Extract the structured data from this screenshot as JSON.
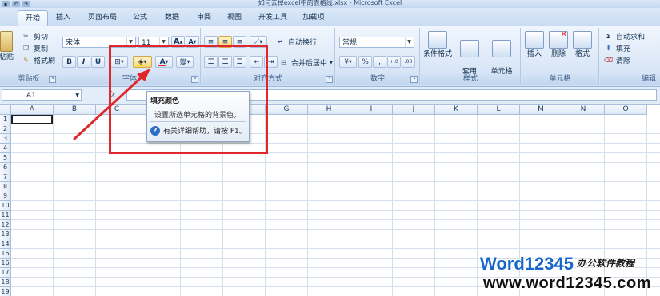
{
  "window": {
    "title": "如何去掉excel中的表格线.xlsx - Microsoft Excel"
  },
  "tabs": [
    {
      "label": "开始",
      "active": true
    },
    {
      "label": "插入"
    },
    {
      "label": "页面布局"
    },
    {
      "label": "公式"
    },
    {
      "label": "数据"
    },
    {
      "label": "审阅"
    },
    {
      "label": "视图"
    },
    {
      "label": "开发工具"
    },
    {
      "label": "加载项"
    }
  ],
  "ribbon": {
    "clipboard": {
      "paste": "粘贴",
      "cut": "剪切",
      "copy": "复制",
      "format_painter": "格式刷",
      "label": "剪贴板"
    },
    "font": {
      "font_name": "宋体",
      "font_size": "11",
      "bold": "B",
      "italic": "I",
      "underline": "U",
      "grow": "A",
      "shrink": "A",
      "font_color": "A",
      "phonetic": "變",
      "label": "字体"
    },
    "alignment": {
      "wrap_text": "自动换行",
      "merge_center": "合并后居中",
      "label": "对齐方式"
    },
    "number": {
      "format": "常规",
      "percent": "%",
      "comma": ",",
      "increase_decimal": "+.0",
      "decrease_decimal": ".00",
      "label": "数字"
    },
    "styles": {
      "conditional": "条件格式",
      "table": "套用\n表格格式",
      "cell_styles": "单元格\n样式",
      "label": "样式"
    },
    "cells": {
      "insert": "插入",
      "delete": "删除",
      "format": "格式",
      "label": "单元格"
    },
    "editing": {
      "autosum": "自动求和",
      "fill": "填充",
      "clear": "清除",
      "label": "编辑"
    }
  },
  "formula_bar": {
    "name_box": "A1",
    "fx": "fx",
    "value": ""
  },
  "columns": [
    "A",
    "B",
    "C",
    "D",
    "E",
    "F",
    "G",
    "H",
    "I",
    "J",
    "K",
    "L",
    "M",
    "N",
    "O"
  ],
  "rows": [
    "1",
    "2",
    "3",
    "4",
    "5",
    "6",
    "7",
    "8",
    "9",
    "10",
    "11",
    "12",
    "13",
    "14",
    "15",
    "16",
    "17",
    "18",
    "19"
  ],
  "tooltip": {
    "title": "填充颜色",
    "description": "设置所选单元格的背景色。",
    "help": "有关详细帮助，请按 F1。"
  },
  "watermark": {
    "brand": "Word12345",
    "brand_cn": "办公软件教程",
    "url": "www.word12345.com"
  },
  "colors": {
    "annotation": "#e0272c",
    "ribbon": "#dde9f8",
    "fill_swatch": "#f5e31a",
    "font_swatch": "#e0272c"
  }
}
